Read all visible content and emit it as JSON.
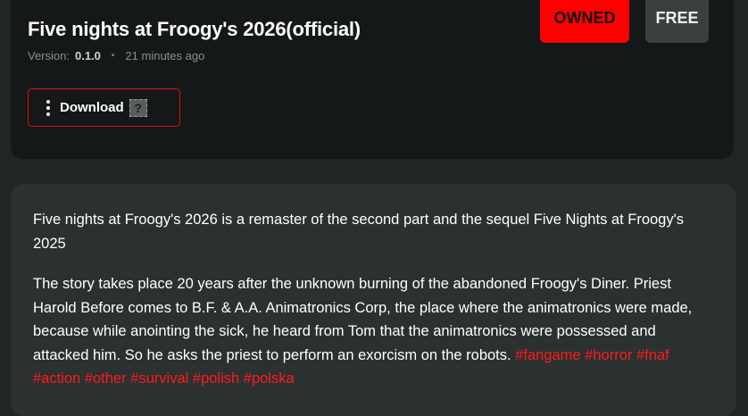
{
  "header": {
    "title": "Five nights at Froogy's 2026(official)",
    "version_label": "Version:",
    "version_value": "0.1.0",
    "dot": "•",
    "updated": "21 minutes ago",
    "owned_badge": "OWNED",
    "free_badge": "FREE",
    "download_label": "Download",
    "download_emoji_placeholder": "?"
  },
  "description": {
    "paragraph1": "Five nights at Froogy's 2026 is a remaster of the second part and the sequel Five Nights at Froogy's 2025",
    "paragraph2": "The story takes place 20 years after the unknown burning of the abandoned Froogy's Diner. Priest Harold Before comes to B.F. & A.A. Animatronics Corp, the place where the animatronics were made, because while anointing the sick, he heard from Tom that the animatronics were possessed and attacked him. So he asks the priest to perform an exorcism on the robots.",
    "tags": [
      "#fangame",
      "#horror",
      "#fnaf",
      "#action",
      "#other",
      "#survival",
      "#polish",
      "#polska"
    ]
  },
  "colors": {
    "accent_red": "#ff0000",
    "tag_red": "#ff1a1a",
    "background": "#1f2624"
  }
}
